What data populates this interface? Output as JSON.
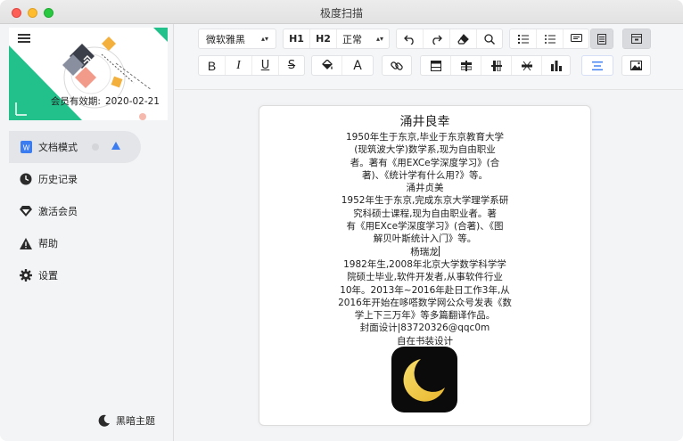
{
  "window": {
    "title": "极度扫描"
  },
  "sidebar": {
    "banner": {
      "expire_label": "会员有效期:",
      "expire_date": "2020-02-21"
    },
    "items": [
      {
        "label": "文档模式",
        "icon": "document-icon",
        "active": true
      },
      {
        "label": "历史记录",
        "icon": "clock-icon"
      },
      {
        "label": "激活会员",
        "icon": "diamond-icon"
      },
      {
        "label": "帮助",
        "icon": "help-icon"
      },
      {
        "label": "设置",
        "icon": "gear-icon"
      }
    ],
    "theme_label": "黑暗主题"
  },
  "toolbar": {
    "font_family": "微软雅黑",
    "heading1": "H1",
    "heading2": "H2",
    "paragraph_style": "正常",
    "text_color_glyph": "A",
    "colors": {
      "accent": "#3b7cf0",
      "selected_bg": "#d8dadd"
    }
  },
  "document": {
    "lines": [
      "涌井良幸",
      "1950年生于东京,毕业于东京教育大学",
      "(现筑波大学)数学系,现为自由职业",
      "者。著有《用EXCe学深度学习》(合",
      "著)、《统计学有什么用?》等。",
      "涌井贞美",
      "1952年生于东京,完成东京大学理学系研",
      "究科硕士课程,现为自由职业者。著",
      "有《用EXce学深度学习》(合著)、《图",
      "解贝叶斯统计入门》等。",
      "杨瑞龙",
      "1982年生,2008年北京大学数学科学学",
      "院硕士毕业,软件开发者,从事软件行业",
      "10年。2013年~2016年赴日工作3年,从",
      "2016年开始在哆嗒数学网公众号发表《数",
      "学上下三万年》等多篇翻译作品。",
      "封面设计|83720326@qqc0m",
      "自在书装设计"
    ]
  }
}
